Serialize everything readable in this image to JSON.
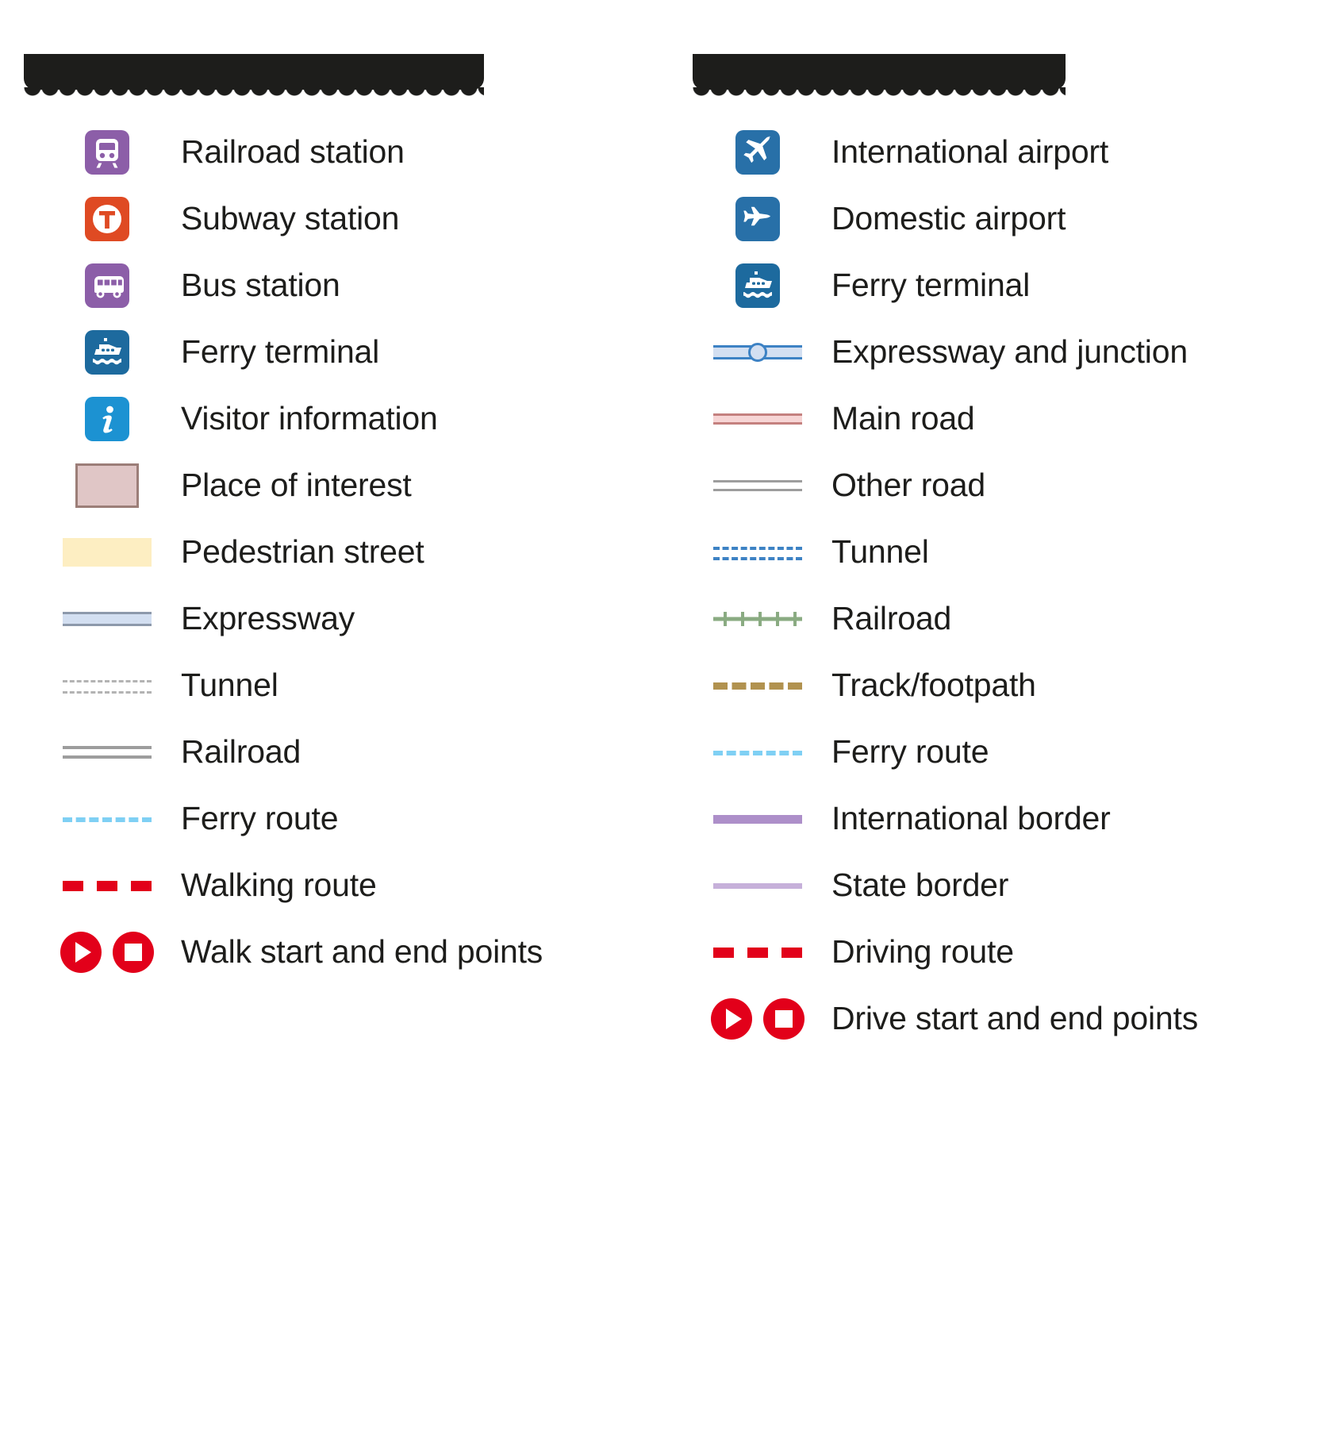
{
  "page": {
    "background": "#ffffff",
    "text_color": "#1d1d1b"
  },
  "headers": {
    "left": {
      "redacted": true,
      "label": ""
    },
    "right": {
      "redacted": true,
      "label": ""
    }
  },
  "colors": {
    "purple": "#8c5ea8",
    "orange_red": "#df4a23",
    "ferry_blue": "#1d6a9e",
    "info_blue": "#1c92d2",
    "airport_blue": "#2870a8",
    "poi_fill": "#e0c6c6",
    "poi_border": "#9c7e78",
    "pedestrian_yellow": "#fdeec2",
    "expressway_fill": "#d3dff1",
    "expressway_border": "#8d99ab",
    "expressway_blue_border": "#3d82c4",
    "tunnel_gray": "#b3b3b3",
    "railroad_gray": "#9d9d9d",
    "ferry_route_blue": "#7fd0f4",
    "route_red": "#e2001a",
    "main_road_fill": "#f7d5d5",
    "main_road_border": "#c4817f",
    "other_road_gray": "#9d9d9d",
    "tunnel_blue": "#3d82c4",
    "railroad_green": "#8aab82",
    "track_brown": "#b1924f",
    "intl_border_purple": "#ad8fc9",
    "state_border_purple": "#c6b0da"
  },
  "left_column": {
    "items": [
      {
        "label": "Railroad station",
        "swatch": "pictogram",
        "icon": "train-icon"
      },
      {
        "label": "Subway station",
        "swatch": "pictogram",
        "icon": "subway-t-icon"
      },
      {
        "label": "Bus station",
        "swatch": "pictogram",
        "icon": "bus-icon"
      },
      {
        "label": "Ferry terminal",
        "swatch": "pictogram",
        "icon": "ferry-icon"
      },
      {
        "label": "Visitor information",
        "swatch": "pictogram",
        "icon": "information-i-icon"
      },
      {
        "label": "Place of interest",
        "swatch": "area",
        "icon": "place-of-interest-swatch"
      },
      {
        "label": "Pedestrian street",
        "swatch": "band",
        "icon": "pedestrian-street-swatch"
      },
      {
        "label": "Expressway",
        "swatch": "line",
        "icon": "expressway-swatch"
      },
      {
        "label": "Tunnel",
        "swatch": "line",
        "icon": "tunnel-swatch"
      },
      {
        "label": "Railroad",
        "swatch": "line",
        "icon": "railroad-swatch"
      },
      {
        "label": "Ferry route",
        "swatch": "line",
        "icon": "ferry-route-swatch"
      },
      {
        "label": "Walking route",
        "swatch": "line",
        "icon": "walking-route-swatch"
      },
      {
        "label": "Walk start and end points",
        "swatch": "markers",
        "icon": "walk-start-end-markers"
      }
    ]
  },
  "right_column": {
    "items": [
      {
        "label": "International airport",
        "swatch": "pictogram",
        "icon": "international-airport-icon"
      },
      {
        "label": "Domestic airport",
        "swatch": "pictogram",
        "icon": "domestic-airport-icon"
      },
      {
        "label": "Ferry terminal",
        "swatch": "pictogram",
        "icon": "ferry-icon"
      },
      {
        "label": "Expressway and junction",
        "swatch": "line",
        "icon": "expressway-junction-swatch"
      },
      {
        "label": "Main road",
        "swatch": "line",
        "icon": "main-road-swatch"
      },
      {
        "label": "Other road",
        "swatch": "line",
        "icon": "other-road-swatch"
      },
      {
        "label": "Tunnel",
        "swatch": "line",
        "icon": "tunnel-dashed-swatch"
      },
      {
        "label": "Railroad",
        "swatch": "line",
        "icon": "railroad-ticked-swatch"
      },
      {
        "label": "Track/footpath",
        "swatch": "line",
        "icon": "track-footpath-swatch"
      },
      {
        "label": "Ferry route",
        "swatch": "line",
        "icon": "ferry-route-swatch"
      },
      {
        "label": "International border",
        "swatch": "line",
        "icon": "international-border-swatch"
      },
      {
        "label": "State border",
        "swatch": "line",
        "icon": "state-border-swatch"
      },
      {
        "label": "Driving route",
        "swatch": "line",
        "icon": "driving-route-swatch"
      },
      {
        "label": "Drive start and end points",
        "swatch": "markers",
        "icon": "drive-start-end-markers"
      }
    ]
  }
}
